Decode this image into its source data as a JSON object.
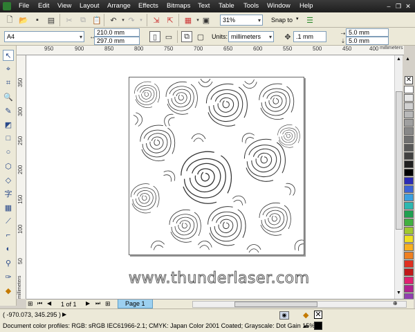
{
  "menu": {
    "items": [
      "File",
      "Edit",
      "View",
      "Layout",
      "Arrange",
      "Effects",
      "Bitmaps",
      "Text",
      "Table",
      "Tools",
      "Window",
      "Help"
    ]
  },
  "toolbar": {
    "zoom_level": "31%",
    "snap_to_label": "Snap to"
  },
  "property_bar": {
    "page_size": "A4",
    "page_width": "210.0 mm",
    "page_height": "297.0 mm",
    "units_label": "Units:",
    "units_value": "millimeters",
    "nudge_value": ".1 mm",
    "duplicate_x": "5.0 mm",
    "duplicate_y": "5.0 mm"
  },
  "ruler_top": {
    "ticks": [
      "950",
      "900",
      "850",
      "800",
      "750",
      "700",
      "650",
      "600",
      "550",
      "500",
      "450",
      "400"
    ],
    "unit_label": "millimeters"
  },
  "ruler_left": {
    "ticks": [
      "350",
      "300",
      "250",
      "200",
      "150",
      "100",
      "50"
    ],
    "unit_label": "millimeters"
  },
  "canvas": {
    "watermark": "www.thunderlaser.com"
  },
  "page_navigator": {
    "page_counter": "1 of 1",
    "page_tab": "Page 1"
  },
  "status": {
    "coordinates": "( -970.073, 345.295 )",
    "color_profiles": "Document color profiles: RGB: sRGB IEC61966-2.1; CMYK: Japan Color 2001 Coated; Grayscale: Dot Gain 15%"
  },
  "palette": {
    "colors": [
      "#ffffff",
      "#e8e8e8",
      "#d0d0d0",
      "#b8b8b8",
      "#a0a0a0",
      "#888888",
      "#707070",
      "#585858",
      "#404040",
      "#202020",
      "#000000",
      "#2b2bb4",
      "#3c63d6",
      "#3aa0e0",
      "#2cb8b0",
      "#20a050",
      "#40b040",
      "#a0c830",
      "#f0e020",
      "#f8b020",
      "#f08020",
      "#e03020",
      "#c01818",
      "#e02070",
      "#b02090",
      "#9040b0",
      "#f0c0a0",
      "#8a5030"
    ]
  },
  "colors": {
    "menubar_bg": "#2b2b2b",
    "page_tab_bg": "#9cd0f0",
    "fill_indicator": "#000000"
  }
}
